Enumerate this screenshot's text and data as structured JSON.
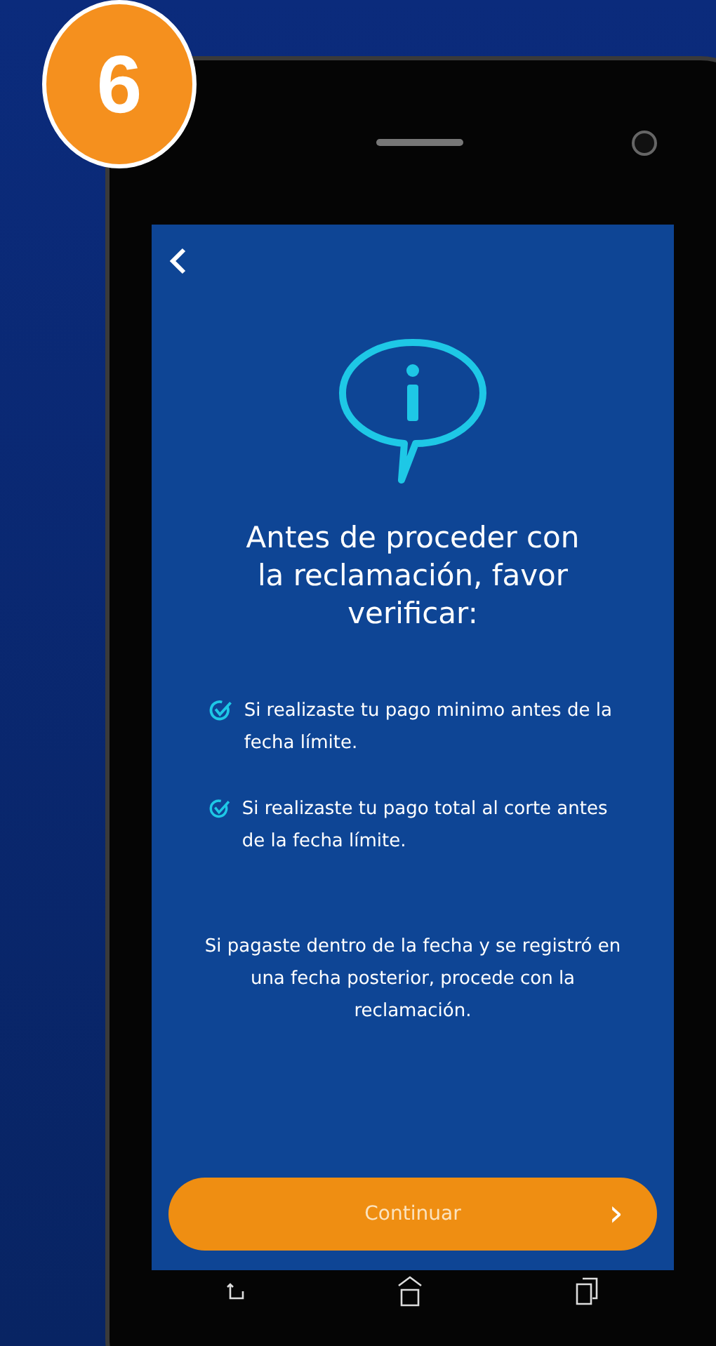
{
  "step_badge": "6",
  "screen": {
    "title": "Antes de proceder con la reclamación, favor verificar:",
    "checklist": [
      {
        "text": "Si realizaste tu pago minimo antes de la fecha límite."
      },
      {
        "text": "Si realizaste tu pago total al corte antes de la fecha límite."
      }
    ],
    "note": "Si pagaste dentro de la fecha y se registró en una fecha posterior, procede con la reclamación.",
    "button": {
      "label": "Continuar",
      "arrow": "›"
    }
  }
}
